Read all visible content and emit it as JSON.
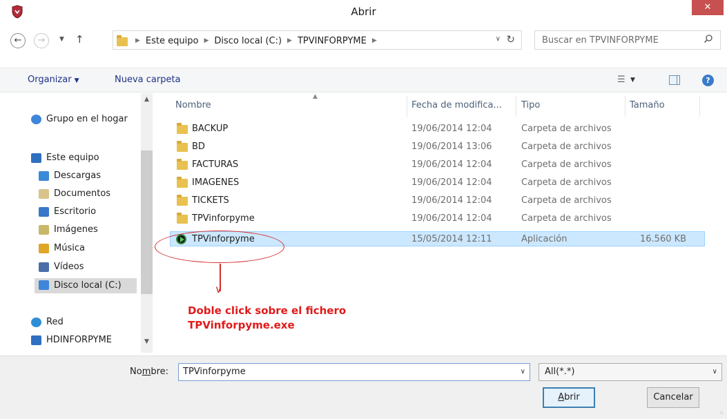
{
  "window": {
    "title": "Abrir",
    "close_label": "✕"
  },
  "address": {
    "crumbs": [
      "Este equipo",
      "Disco local (C:)",
      "TPVINFORPYME"
    ],
    "search_placeholder": "Buscar en TPVINFORPYME"
  },
  "toolbar": {
    "organize_label": "Organizar",
    "new_folder_label": "Nueva carpeta"
  },
  "nav": {
    "items": [
      {
        "label": "Grupo en el hogar",
        "icon": "homegroup-icon",
        "color": "#3f86d8"
      },
      {
        "label": "Este equipo",
        "icon": "computer-icon",
        "color": "#2f6fc0"
      },
      {
        "label": "Descargas",
        "icon": "downloads-folder-icon",
        "color": "#3a8ad8"
      },
      {
        "label": "Documentos",
        "icon": "documents-folder-icon",
        "color": "#d8c48a"
      },
      {
        "label": "Escritorio",
        "icon": "desktop-folder-icon",
        "color": "#3978c8"
      },
      {
        "label": "Imágenes",
        "icon": "pictures-folder-icon",
        "color": "#c9b76a"
      },
      {
        "label": "Música",
        "icon": "music-folder-icon",
        "color": "#e0a628"
      },
      {
        "label": "Vídeos",
        "icon": "videos-folder-icon",
        "color": "#4a6fa8"
      },
      {
        "label": "Disco local (C:)",
        "icon": "local-disk-icon",
        "color": "#3f86d8",
        "selected": true
      },
      {
        "label": "Red",
        "icon": "network-icon",
        "color": "#2f8fd6"
      },
      {
        "label": "HDINFORPYME",
        "icon": "computer-icon",
        "color": "#2f6fc0"
      }
    ]
  },
  "columns": {
    "name": "Nombre",
    "date": "Fecha de modifica...",
    "type": "Tipo",
    "size": "Tamaño"
  },
  "files": [
    {
      "name": "BACKUP",
      "date": "19/06/2014 12:04",
      "type": "Carpeta de archivos",
      "size": "",
      "kind": "folder"
    },
    {
      "name": "BD",
      "date": "19/06/2014 13:06",
      "type": "Carpeta de archivos",
      "size": "",
      "kind": "folder"
    },
    {
      "name": "FACTURAS",
      "date": "19/06/2014 12:04",
      "type": "Carpeta de archivos",
      "size": "",
      "kind": "folder"
    },
    {
      "name": "IMAGENES",
      "date": "19/06/2014 12:04",
      "type": "Carpeta de archivos",
      "size": "",
      "kind": "folder"
    },
    {
      "name": "TICKETS",
      "date": "19/06/2014 12:04",
      "type": "Carpeta de archivos",
      "size": "",
      "kind": "folder"
    },
    {
      "name": "TPVinforpyme",
      "date": "19/06/2014 12:04",
      "type": "Carpeta de archivos",
      "size": "",
      "kind": "folder"
    },
    {
      "name": "TPVinforpyme",
      "date": "15/05/2014 12:11",
      "type": "Aplicación",
      "size": "16.560 KB",
      "kind": "app",
      "selected": true
    }
  ],
  "annotation": {
    "line1": "Doble click sobre el fichero",
    "line2": "TPVinforpyme.exe",
    "color": "#e11a1a"
  },
  "bottom": {
    "name_label_pre": "No",
    "name_label_u": "m",
    "name_label_post": "bre:",
    "name_value": "TPVinforpyme",
    "filter_value": "All(*.*)",
    "open_label_u": "A",
    "open_label_rest": "brir",
    "cancel_label": "Cancelar"
  }
}
